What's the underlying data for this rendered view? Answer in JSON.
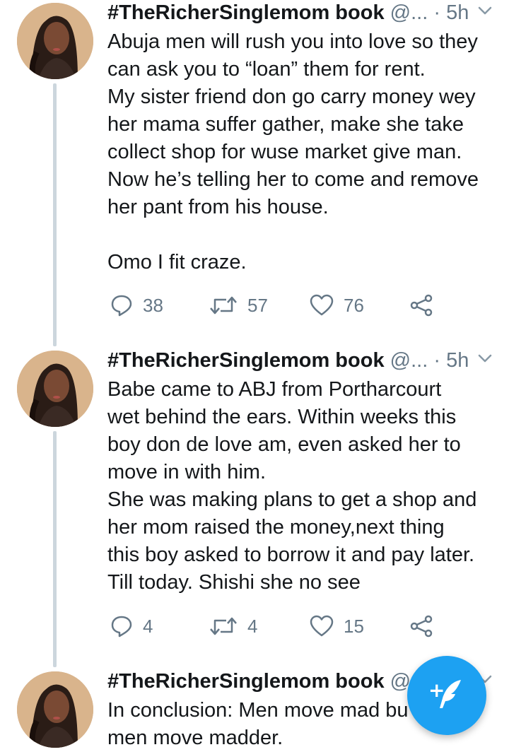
{
  "colors": {
    "accent": "#1da1f2",
    "muted": "#657786",
    "thread_line": "#ccd6dd",
    "text": "#14171a"
  },
  "tweets": [
    {
      "author": "#TheRicherSinglemom book",
      "handle": "@...",
      "separator": "·",
      "time": "5h",
      "lines": [
        "Abuja men will rush you into love so they",
        "can ask you to “loan” them for rent.",
        "My sister friend don go carry money wey",
        "her mama suffer gather, make she take",
        "collect shop for wuse market give man.",
        "Now he’s telling her to come and remove",
        "her pant from his house.",
        "",
        "Omo I fit craze."
      ],
      "replies": "38",
      "retweets": "57",
      "likes": "76"
    },
    {
      "author": "#TheRicherSinglemom book",
      "handle": "@...",
      "separator": "·",
      "time": "5h",
      "lines": [
        "Babe came to ABJ from Portharcourt",
        "wet behind the ears. Within weeks this",
        "boy don de love am, even asked her to",
        "move in with him.",
        "She was making plans to get a shop and",
        "her mom raised the money,next thing",
        "this boy asked to borrow it and pay later.",
        "Till today. Shishi she no see"
      ],
      "replies": "4",
      "retweets": "4",
      "likes": "15"
    },
    {
      "author": "#TheRicherSinglemom book",
      "handle": "@.",
      "lines": [
        "In conclusion: Men move mad bu",
        "men move madder."
      ]
    }
  ],
  "icons": {
    "reply": "reply-icon",
    "retweet": "retweet-icon",
    "like": "like-icon",
    "share": "share-icon",
    "menu": "chevron-down-icon",
    "compose": "compose-icon"
  },
  "compose_symbol": "+"
}
